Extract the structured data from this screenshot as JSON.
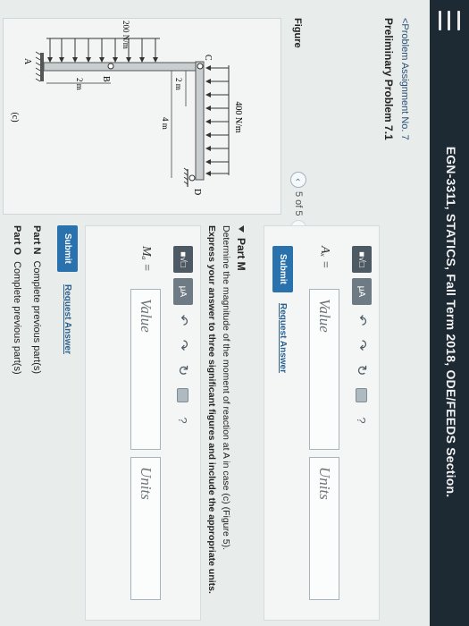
{
  "header": {
    "course_title": "EGN-3311, STATICS, Fall Term 2018, ODE/FEEDS Section."
  },
  "nav": {
    "breadcrumb": "<Problem Assignment No. 7",
    "problem_title": "Preliminary Problem 7.1"
  },
  "figure": {
    "label": "Figure",
    "pager_text": "5 of 5",
    "caption": "(c)",
    "load_top": "400 N/m",
    "load_side": "200 N/m",
    "dim_2m_top": "2 m",
    "dim_4m": "4 m",
    "dim_2m_side": "2 m",
    "point_c": "C",
    "point_d": "D",
    "point_b": "B",
    "point_a": "A"
  },
  "toolbar": {
    "templates_label": "■√□",
    "mu_label": "μA",
    "undo_icon": "↶",
    "redo_icon": "↷",
    "reset_icon": "↻",
    "help_icon": "?"
  },
  "part_prev": {
    "eq_label": "Aₓ =",
    "value_placeholder": "Value",
    "units_placeholder": "Units",
    "submit_label": "Submit",
    "request_label": "Request Answer"
  },
  "part_m": {
    "title": "Part M",
    "description": "Determine the magnitude of the moment of reaction at A in case (c) (Figure 5).",
    "instructions": "Express your answer to three significant figures and include the appropriate units.",
    "eq_label": "Mₐ =",
    "value_placeholder": "Value",
    "units_placeholder": "Units",
    "submit_label": "Submit",
    "request_label": "Request Answer"
  },
  "part_n": {
    "label": "Part N",
    "text": "Complete previous part(s)"
  },
  "part_o": {
    "label": "Part O",
    "text": "Complete previous part(s)"
  }
}
